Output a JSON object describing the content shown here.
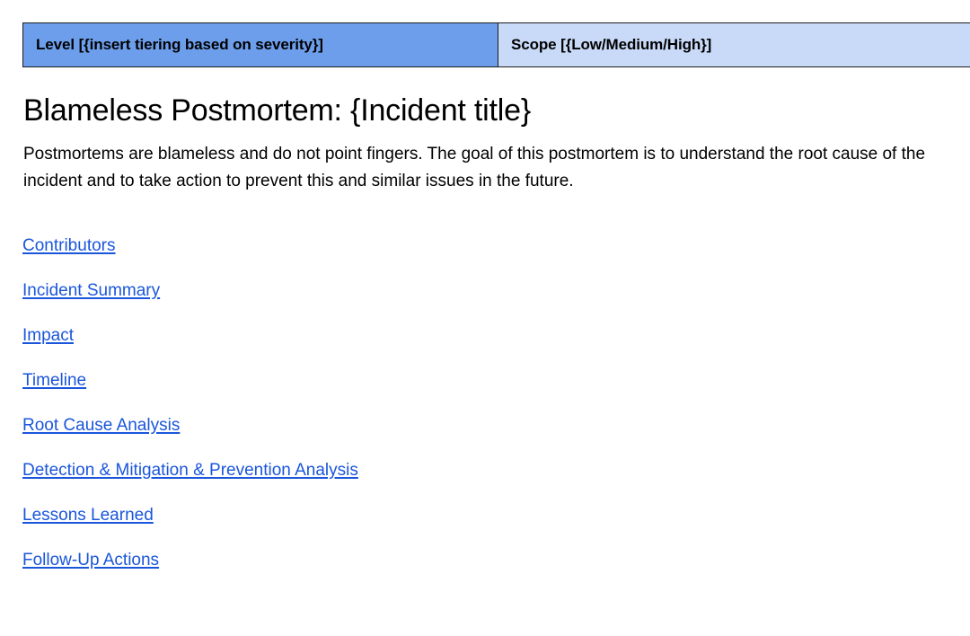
{
  "meta_table": {
    "rows": [
      {
        "level_cell": "Level [{insert tiering based on severity}]",
        "scope_cell": "Scope [{Low/Medium/High}]"
      }
    ],
    "colors": {
      "level_bg": "#6d9eeb",
      "scope_bg": "#c9daf8",
      "border": "#1c1c1c"
    }
  },
  "document": {
    "title": "Blameless Postmortem: {Incident title}",
    "intro": "Postmortems are blameless and do not point fingers. The goal of this postmortem is to understand the root cause of the incident and to take action to prevent this and similar issues in the future."
  },
  "table_of_contents": {
    "link_color": "#1a56db",
    "items": [
      {
        "label": "Contributors"
      },
      {
        "label": "Incident Summary"
      },
      {
        "label": "Impact"
      },
      {
        "label": "Timeline"
      },
      {
        "label": "Root Cause Analysis"
      },
      {
        "label": "Detection & Mitigation & Prevention Analysis"
      },
      {
        "label": "Lessons Learned"
      },
      {
        "label": "Follow-Up Actions"
      }
    ]
  }
}
